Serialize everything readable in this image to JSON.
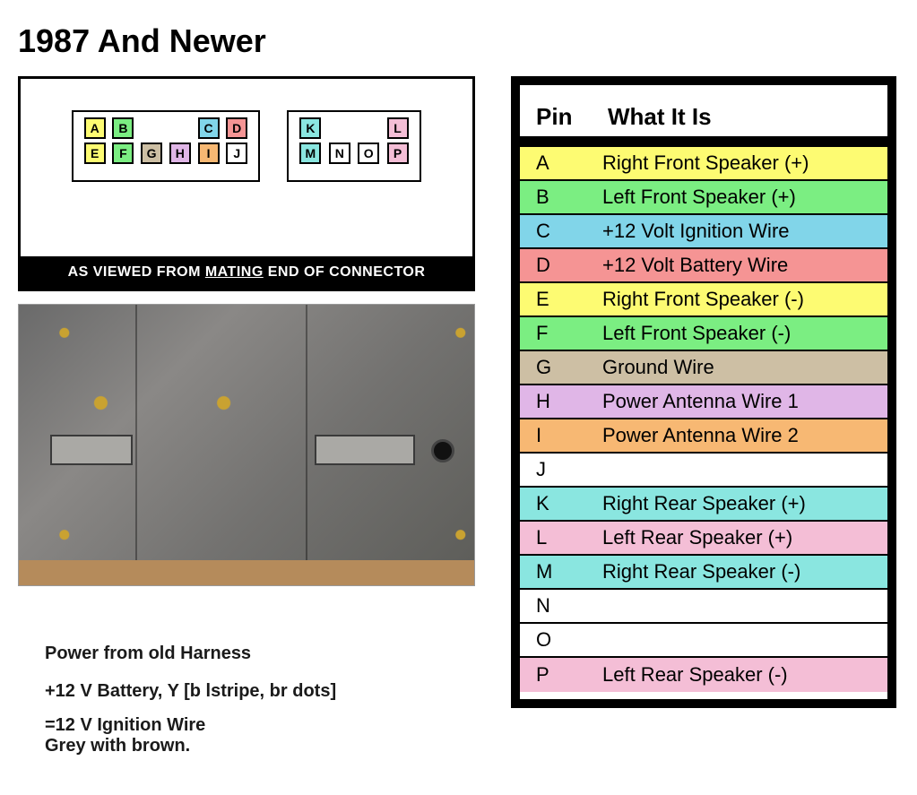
{
  "title": "1987 And Newer",
  "connector_caption_pre": "AS VIEWED FROM ",
  "connector_caption_u": "MATING",
  "connector_caption_post": " END OF CONNECTOR",
  "connA_top": [
    {
      "l": "A",
      "c": "c-yellow"
    },
    {
      "l": "B",
      "c": "c-green"
    },
    {
      "l": "",
      "c": ""
    },
    {
      "l": "",
      "c": ""
    },
    {
      "l": "C",
      "c": "c-blue"
    },
    {
      "l": "D",
      "c": "c-red"
    }
  ],
  "connA_bottom": [
    {
      "l": "E",
      "c": "c-yellow"
    },
    {
      "l": "F",
      "c": "c-green"
    },
    {
      "l": "G",
      "c": "c-tan"
    },
    {
      "l": "H",
      "c": "c-violet"
    },
    {
      "l": "I",
      "c": "c-orange"
    },
    {
      "l": "J",
      "c": "c-white"
    }
  ],
  "connB_top": [
    {
      "l": "K",
      "c": "c-cyan"
    },
    {
      "l": "",
      "c": ""
    },
    {
      "l": "",
      "c": ""
    },
    {
      "l": "L",
      "c": "c-pink"
    }
  ],
  "connB_bottom": [
    {
      "l": "M",
      "c": "c-cyan"
    },
    {
      "l": "N",
      "c": "c-white"
    },
    {
      "l": "O",
      "c": "c-white"
    },
    {
      "l": "P",
      "c": "c-pink"
    }
  ],
  "table": {
    "head_pin": "Pin",
    "head_desc": "What It Is",
    "rows": [
      {
        "pin": "A",
        "desc": "Right Front Speaker (+)",
        "c": "c-yellow"
      },
      {
        "pin": "B",
        "desc": "Left Front Speaker (+)",
        "c": "c-green"
      },
      {
        "pin": "C",
        "desc": "+12 Volt Ignition Wire",
        "c": "c-blue"
      },
      {
        "pin": "D",
        "desc": "+12 Volt Battery Wire",
        "c": "c-red"
      },
      {
        "pin": "E",
        "desc": "Right Front Speaker (-)",
        "c": "c-yellow"
      },
      {
        "pin": "F",
        "desc": "Left Front Speaker (-)",
        "c": "c-green"
      },
      {
        "pin": "G",
        "desc": "Ground Wire",
        "c": "c-tan"
      },
      {
        "pin": "H",
        "desc": "Power Antenna Wire 1",
        "c": "c-violet"
      },
      {
        "pin": "I",
        "desc": "Power Antenna Wire 2",
        "c": "c-orange"
      },
      {
        "pin": "J",
        "desc": "",
        "c": "c-white"
      },
      {
        "pin": "K",
        "desc": "Right Rear Speaker (+)",
        "c": "c-cyan"
      },
      {
        "pin": "L",
        "desc": "Left Rear Speaker (+)",
        "c": "c-pink"
      },
      {
        "pin": "M",
        "desc": "Right Rear Speaker (-)",
        "c": "c-cyan"
      },
      {
        "pin": "N",
        "desc": "",
        "c": "c-white"
      },
      {
        "pin": "O",
        "desc": "",
        "c": "c-white"
      },
      {
        "pin": "P",
        "desc": "Left Rear Speaker (-)",
        "c": "c-pink"
      }
    ]
  },
  "notes": {
    "l1": "Power from old Harness",
    "l2": "+12 V Battery, Y [b lstripe, br dots]",
    "l3": "=12 V Ignition Wire",
    "l4": "Grey with brown."
  }
}
